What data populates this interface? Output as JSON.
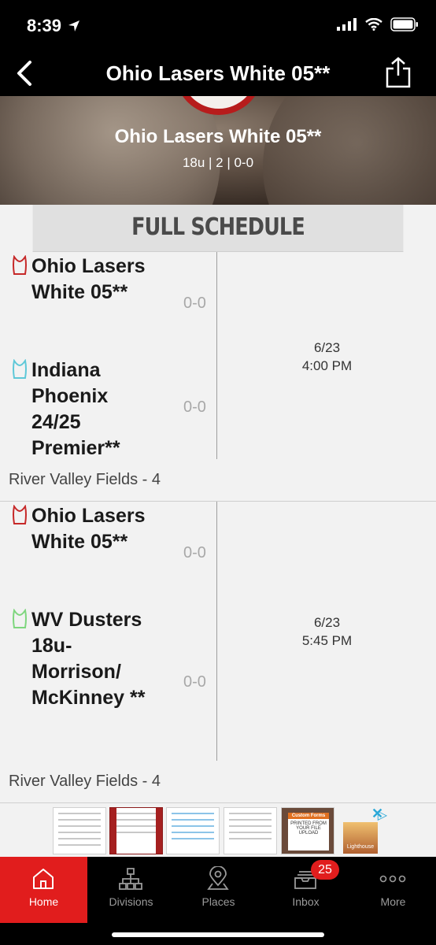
{
  "status": {
    "time": "8:39"
  },
  "nav": {
    "title": "Ohio Lasers White 05**"
  },
  "hero": {
    "team": "Ohio Lasers White 05**",
    "summary": "18u | 2 | 0-0"
  },
  "schedule": {
    "heading": "FULL SCHEDULE",
    "games": [
      {
        "home_team": "Ohio Lasers White 05**",
        "home_score": "0-0",
        "home_color": "#c62828",
        "away_team": "Indiana Phoenix 24/25 Premier**",
        "away_score": "0-0",
        "away_color": "#5ec8d8",
        "date": "6/23",
        "time": "4:00 PM",
        "location": "River Valley Fields - 4"
      },
      {
        "home_team": "Ohio Lasers White 05**",
        "home_score": "0-0",
        "home_color": "#c62828",
        "away_team": "WV Dusters 18u-Morrison/ McKinney **",
        "away_score": "0-0",
        "away_color": "#7ed67e",
        "date": "6/23",
        "time": "5:45 PM",
        "location": "River Valley Fields - 4"
      }
    ]
  },
  "ad": {
    "custom_forms_title": "Custom Forms",
    "custom_forms_text": "PRINTED FROM YOUR FILE UPLOAD",
    "brand": "Lighthouse"
  },
  "tabs": [
    {
      "label": "Home",
      "icon": "home-icon"
    },
    {
      "label": "Divisions",
      "icon": "bracket-icon"
    },
    {
      "label": "Places",
      "icon": "map-pin-icon"
    },
    {
      "label": "Inbox",
      "icon": "inbox-icon"
    },
    {
      "label": "More",
      "icon": "more-dots-icon"
    }
  ],
  "inbox_badge": "25",
  "colors": {
    "accent": "#e11d1d",
    "background": "#f2f2f2"
  }
}
